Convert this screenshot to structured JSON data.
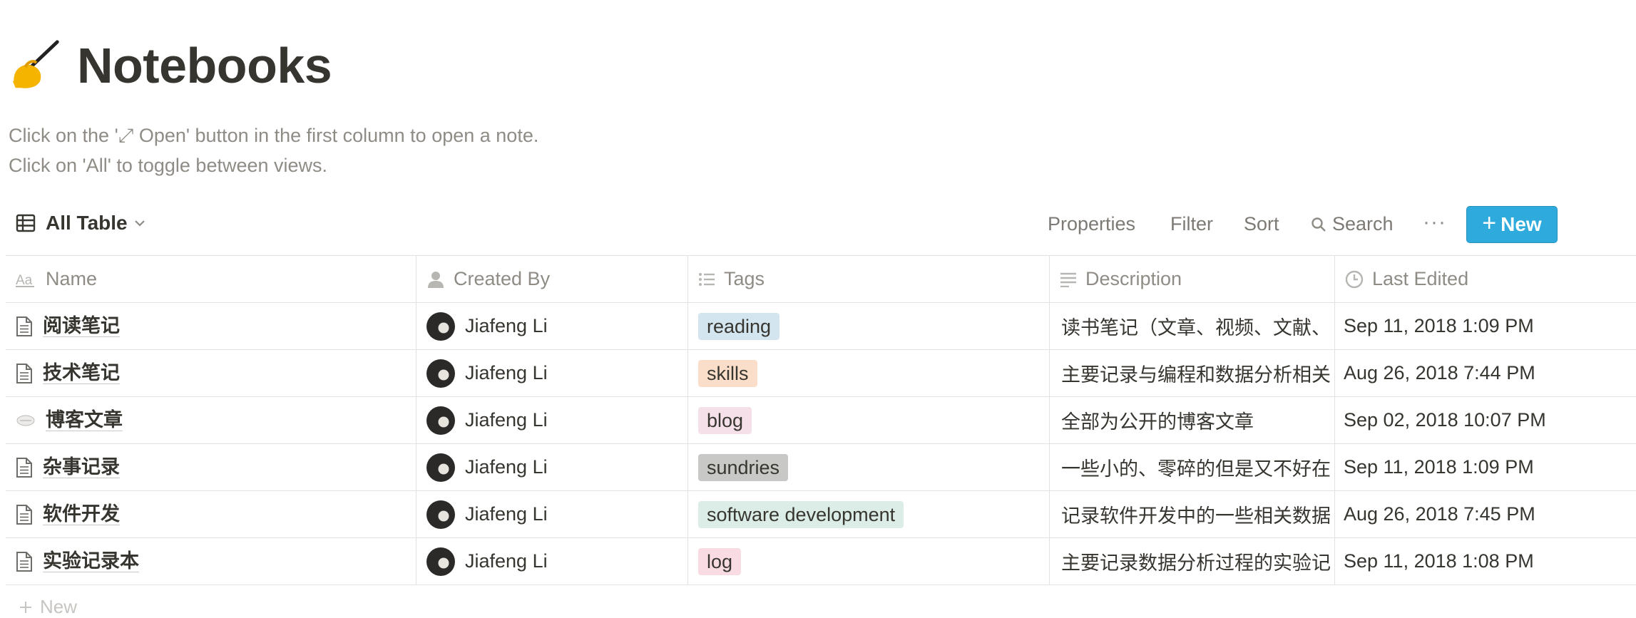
{
  "page": {
    "title": "Notebooks",
    "icon": "writing-hand-emoji",
    "description_lines": [
      "Click on the '⤢ Open' button in the first column to open a note.",
      "Click on 'All' to toggle between views."
    ]
  },
  "toolbar": {
    "view_label": "All Table",
    "properties": "Properties",
    "filter": "Filter",
    "sort": "Sort",
    "search": "Search",
    "more": "···",
    "new_plus": "+",
    "new_label": "New"
  },
  "table": {
    "columns": [
      {
        "label": "Name",
        "icon": "text-aa-icon"
      },
      {
        "label": "Created By",
        "icon": "person-icon"
      },
      {
        "label": "Tags",
        "icon": "list-icon"
      },
      {
        "label": "Description",
        "icon": "text-lines-icon"
      },
      {
        "label": "Last Edited",
        "icon": "clock-icon"
      }
    ],
    "rows": [
      {
        "name": "阅读笔记",
        "icon": "document-icon",
        "created_by": "Jiafeng Li",
        "tag": "reading",
        "tag_color": "#d3e5ef",
        "description": "读书笔记（文章、视频、文献、",
        "last_edited": "Sep 11, 2018 1:09 PM"
      },
      {
        "name": "技术笔记",
        "icon": "document-icon",
        "created_by": "Jiafeng Li",
        "tag": "skills",
        "tag_color": "#fadec9",
        "description": "主要记录与编程和数据分析相关",
        "last_edited": "Aug 26, 2018 7:44 PM"
      },
      {
        "name": "博客文章",
        "icon": "blog-image-icon",
        "created_by": "Jiafeng Li",
        "tag": "blog",
        "tag_color": "#f5e0e9",
        "description": "全部为公开的博客文章",
        "last_edited": "Sep 02, 2018 10:07 PM"
      },
      {
        "name": "杂事记录",
        "icon": "document-icon",
        "created_by": "Jiafeng Li",
        "tag": "sundries",
        "tag_color": "#c8c8c6",
        "description": "一些小的、零碎的但是又不好在",
        "last_edited": "Sep 11, 2018 1:09 PM"
      },
      {
        "name": "软件开发",
        "icon": "document-icon",
        "created_by": "Jiafeng Li",
        "tag": "software development",
        "tag_color": "#dbede6",
        "description": "记录软件开发中的一些相关数据",
        "last_edited": "Aug 26, 2018 7:45 PM"
      },
      {
        "name": "实验记录本",
        "icon": "document-icon",
        "created_by": "Jiafeng Li",
        "tag": "log",
        "tag_color": "#f9dce3",
        "description": "主要记录数据分析过程的实验记",
        "last_edited": "Sep 11, 2018 1:08 PM"
      }
    ],
    "footer_new": "New"
  },
  "colors": {
    "accent": "#2eaadc",
    "text": "#37352f",
    "muted": "#8f8c86",
    "border": "#e3e2e0"
  }
}
